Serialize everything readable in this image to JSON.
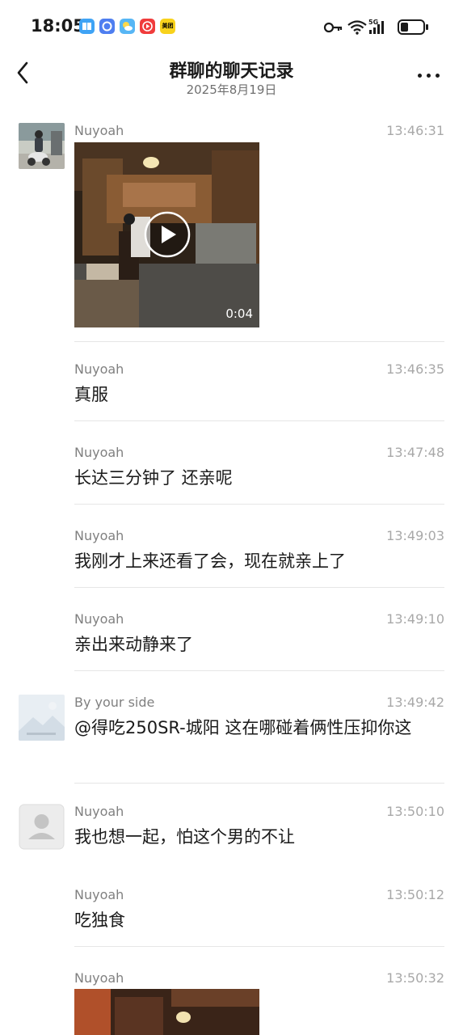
{
  "status_bar": {
    "time": "18:05",
    "app_icons": [
      {
        "name": "reader-icon",
        "color": "#3fa3f5",
        "label": ""
      },
      {
        "name": "browser-icon",
        "color": "#4e7ef0",
        "label": ""
      },
      {
        "name": "weather-icon",
        "color": "#57b6f5",
        "label": ""
      },
      {
        "name": "video-app-icon",
        "color": "#f03c3c",
        "label": ""
      },
      {
        "name": "meituan-icon",
        "color": "#f8d21c",
        "label": "美团"
      }
    ],
    "network": "5G",
    "battery_level": 0.35
  },
  "nav": {
    "title": "群聊的聊天记录",
    "subtitle": "2025年8月19日"
  },
  "messages": [
    {
      "sender": "Nuyoah",
      "time": "13:46:31",
      "type": "video",
      "duration": "0:04"
    },
    {
      "sender": "Nuyoah",
      "time": "13:46:35",
      "type": "text",
      "text": "真服"
    },
    {
      "sender": "Nuyoah",
      "time": "13:47:48",
      "type": "text",
      "text": "长达三分钟了 还亲呢"
    },
    {
      "sender": "Nuyoah",
      "time": "13:49:03",
      "type": "text",
      "text": "我刚才上来还看了会，现在就亲上了"
    },
    {
      "sender": "Nuyoah",
      "time": "13:49:10",
      "type": "text",
      "text": "亲出来动静来了"
    },
    {
      "sender": "By your side",
      "time": "13:49:42",
      "type": "text",
      "text": "@得吃250SR-城阳 这在哪碰着俩性压抑你这"
    },
    {
      "sender": "Nuyoah",
      "time": "13:50:10",
      "type": "text",
      "text": "我也想一起，怕这个男的不让"
    },
    {
      "sender": "Nuyoah",
      "time": "13:50:12",
      "type": "text",
      "text": "吃独食"
    },
    {
      "sender": "Nuyoah",
      "time": "13:50:32",
      "type": "video",
      "duration": ""
    }
  ],
  "colors": {
    "sender": "#808080",
    "timestamp": "#a8a8a8",
    "divider": "#e6e6e6"
  }
}
